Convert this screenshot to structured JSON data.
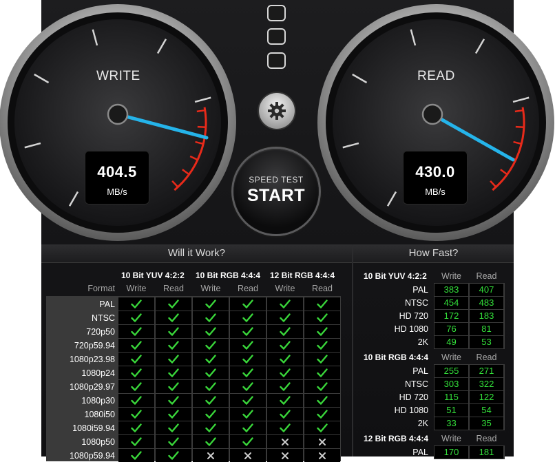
{
  "colors": {
    "needle": "#25b4ea",
    "redzone": "#e82a1a",
    "green": "#33e03a",
    "check": "#39d63a",
    "cross": "#cfcfcf"
  },
  "write_gauge": {
    "label": "WRITE",
    "value": "404.5",
    "unit": "MB/s"
  },
  "read_gauge": {
    "label": "READ",
    "value": "430.0",
    "unit": "MB/s"
  },
  "start_button": {
    "sub": "SPEED TEST",
    "main": "START"
  },
  "settings_icon": "gear-icon",
  "will_it_work": {
    "title": "Will it Work?",
    "format_header": "Format",
    "groups": [
      "10 Bit YUV 4:2:2",
      "10 Bit RGB 4:4:4",
      "12 Bit RGB 4:4:4"
    ],
    "subheaders": [
      "Write",
      "Read",
      "Write",
      "Read",
      "Write",
      "Read"
    ],
    "rows": [
      {
        "format": "PAL",
        "marks": [
          1,
          1,
          1,
          1,
          1,
          1
        ]
      },
      {
        "format": "NTSC",
        "marks": [
          1,
          1,
          1,
          1,
          1,
          1
        ]
      },
      {
        "format": "720p50",
        "marks": [
          1,
          1,
          1,
          1,
          1,
          1
        ]
      },
      {
        "format": "720p59.94",
        "marks": [
          1,
          1,
          1,
          1,
          1,
          1
        ]
      },
      {
        "format": "1080p23.98",
        "marks": [
          1,
          1,
          1,
          1,
          1,
          1
        ]
      },
      {
        "format": "1080p24",
        "marks": [
          1,
          1,
          1,
          1,
          1,
          1
        ]
      },
      {
        "format": "1080p29.97",
        "marks": [
          1,
          1,
          1,
          1,
          1,
          1
        ]
      },
      {
        "format": "1080p30",
        "marks": [
          1,
          1,
          1,
          1,
          1,
          1
        ]
      },
      {
        "format": "1080i50",
        "marks": [
          1,
          1,
          1,
          1,
          1,
          1
        ]
      },
      {
        "format": "1080i59.94",
        "marks": [
          1,
          1,
          1,
          1,
          1,
          1
        ]
      },
      {
        "format": "1080p50",
        "marks": [
          1,
          1,
          1,
          1,
          0,
          0
        ]
      },
      {
        "format": "1080p59.94",
        "marks": [
          1,
          1,
          0,
          0,
          0,
          0
        ]
      }
    ]
  },
  "how_fast": {
    "title": "How Fast?",
    "sections": [
      {
        "name": "10 Bit YUV 4:2:2",
        "write_label": "Write",
        "read_label": "Read",
        "rows": [
          {
            "format": "PAL",
            "write": "383",
            "read": "407"
          },
          {
            "format": "NTSC",
            "write": "454",
            "read": "483"
          },
          {
            "format": "HD 720",
            "write": "172",
            "read": "183"
          },
          {
            "format": "HD 1080",
            "write": "76",
            "read": "81"
          },
          {
            "format": "2K",
            "write": "49",
            "read": "53"
          }
        ]
      },
      {
        "name": "10 Bit RGB 4:4:4",
        "write_label": "Write",
        "read_label": "Read",
        "rows": [
          {
            "format": "PAL",
            "write": "255",
            "read": "271"
          },
          {
            "format": "NTSC",
            "write": "303",
            "read": "322"
          },
          {
            "format": "HD 720",
            "write": "115",
            "read": "122"
          },
          {
            "format": "HD 1080",
            "write": "51",
            "read": "54"
          },
          {
            "format": "2K",
            "write": "33",
            "read": "35"
          }
        ]
      },
      {
        "name": "12 Bit RGB 4:4:4",
        "write_label": "Write",
        "read_label": "Read",
        "rows": [
          {
            "format": "PAL",
            "write": "170",
            "read": "181"
          }
        ]
      }
    ]
  }
}
